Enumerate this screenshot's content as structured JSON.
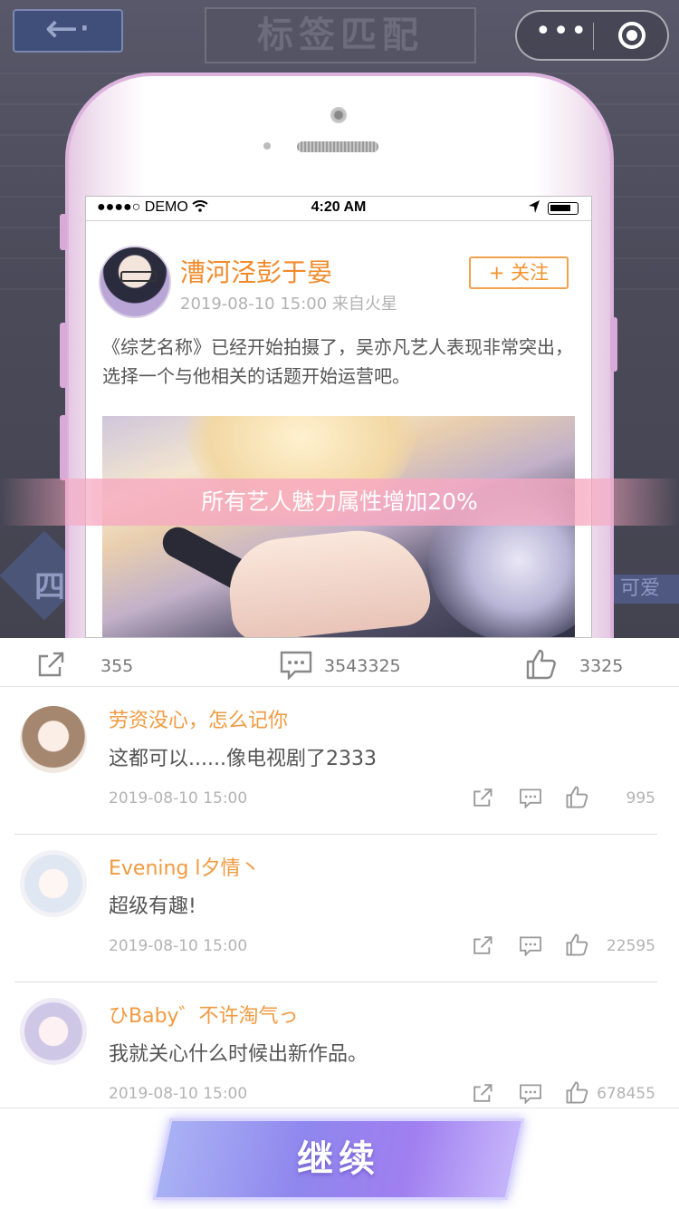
{
  "background": {
    "back_arrow": "←·",
    "title": "标签匹配",
    "left_badge": "四",
    "right_tag": "可爱"
  },
  "capsule": {
    "more": "•••"
  },
  "status_bar": {
    "carrier": "●●●●○ DEMO",
    "time": "4:20 AM"
  },
  "post": {
    "author": "漕河泾彭于晏",
    "meta": "2019-08-10  15:00  来自火星",
    "follow_label": "+ 关注",
    "text": "《综艺名称》已经开始拍摄了，吴亦凡艺人表现非常突出，选择一个与他相关的话题开始运营吧。"
  },
  "buff_banner": "所有艺人魅力属性增加20%",
  "actions": {
    "share_count": "355",
    "comment_count": "3543325",
    "like_count": "3325"
  },
  "comments": [
    {
      "name": "劳资没心，怎么记你",
      "text": "这都可以......像电视剧了2333",
      "time": "2019-08-10  15:00",
      "likes": "995"
    },
    {
      "name": "Evening  l夕情丶",
      "text": "超级有趣!",
      "time": "2019-08-10  15:00",
      "likes": "22595"
    },
    {
      "name": "ひBaby゛不许淘气っ",
      "text": "我就关心什么时候出新作品。",
      "time": "2019-08-10  15:00",
      "likes": "678455"
    }
  ],
  "continue_label": "继续",
  "colors": {
    "accent": "#f28a2a",
    "banner": "#f6a6be",
    "button": "#8f86ee"
  }
}
